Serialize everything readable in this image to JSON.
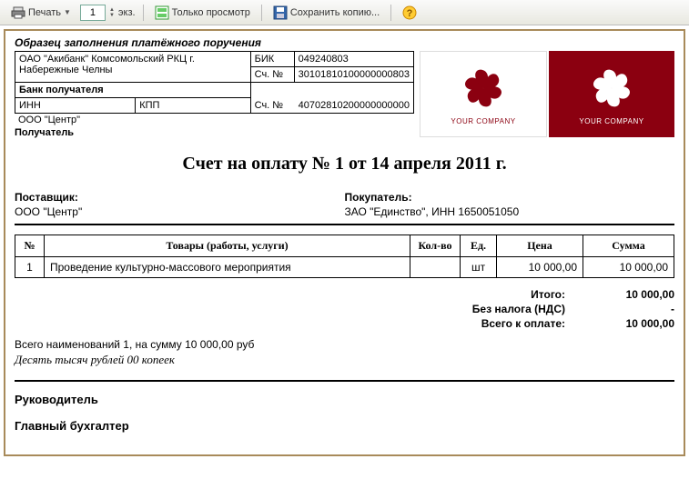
{
  "toolbar": {
    "print_label": "Печать",
    "copies_value": "1",
    "copies_suffix": "экз.",
    "preview_only_label": "Только просмотр",
    "save_copy_label": "Сохранить копию..."
  },
  "sample_caption": "Образец заполнения платёжного поручения",
  "bank": {
    "bank_name": "ОАО \"Акибанк\" Комсомольский РКЦ г. Набережные Челны",
    "bik_label": "БИК",
    "bik_value": "049240803",
    "acct_label": "Сч. №",
    "bank_acct": "30101810100000000803",
    "bank_recipient_label": "Банк получателя",
    "inn_label": "ИНН",
    "inn_value": "",
    "kpp_label": "КПП",
    "kpp_value": "",
    "payer_acct": "40702810200000000000"
  },
  "recipient": {
    "name": "ООО \"Центр\"",
    "label": "Получатель"
  },
  "logo_text": "YOUR COMPANY",
  "title": "Счет на оплату № 1 от 14 апреля 2011 г.",
  "supplier": {
    "label": "Поставщик:",
    "value": "ООО \"Центр\""
  },
  "buyer": {
    "label": "Покупатель:",
    "value": "ЗАО \"Единство\", ИНН 1650051050"
  },
  "items_header": {
    "num": "№",
    "desc": "Товары (работы, услуги)",
    "qty": "Кол-во",
    "unit": "Ед.",
    "price": "Цена",
    "sum": "Сумма"
  },
  "items": [
    {
      "num": "1",
      "desc": "Проведение культурно-массового мероприятия",
      "qty": "",
      "unit": "шт",
      "price": "10 000,00",
      "sum": "10 000,00"
    }
  ],
  "totals": {
    "subtotal_label": "Итого:",
    "subtotal_value": "10 000,00",
    "tax_label": "Без налога (НДС)",
    "tax_value": "-",
    "grand_label": "Всего к оплате:",
    "grand_value": "10 000,00"
  },
  "summary_line": "Всего наименований 1, на сумму 10 000,00 руб",
  "amount_words": "Десять тысяч рублей 00 копеек",
  "signatures": {
    "director": "Руководитель",
    "accountant": "Главный бухгалтер"
  }
}
